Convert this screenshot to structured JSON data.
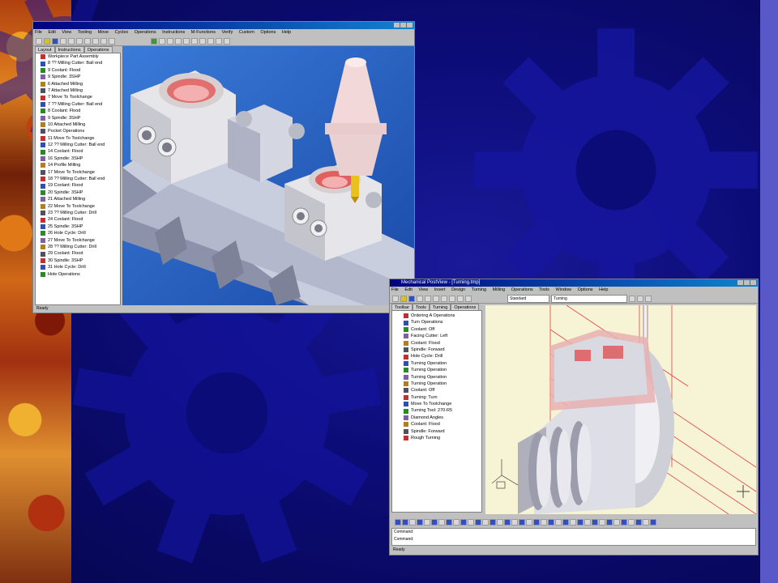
{
  "window1": {
    "title": "",
    "menu": [
      "File",
      "Edit",
      "View",
      "Tooling",
      "Move",
      "Cycles",
      "Operations",
      "Instructions",
      "M-Functions",
      "Verify",
      "Custom",
      "Options",
      "Help"
    ],
    "tabs": [
      "Layout",
      "Instructions",
      "Operations"
    ],
    "tree": [
      "Workpiece Part Assembly",
      "8 ?? Milling Cutter: Ball end",
      "9 Coolant: Flood",
      "9 Spindle: 3SHP",
      "6 Attached Milling",
      "7 Attached Milling",
      "7 Move To Toolchange",
      "7 ?? Milling Cutter: Ball end",
      "8 Coolant: Flood",
      "9 Spindle: 3SHP",
      "10 Attached Milling",
      "Pocket Operations",
      "11 Move To Toolchange",
      "12 ?? Milling Cutter: Ball end",
      "14 Coolant: Flood",
      "16 Spindle: 3SHP",
      "14 Profile Milling",
      "17 Move To Toolchange",
      "18 ?? Milling Cutter: Ball end",
      "19 Coolant: Flood",
      "20 Spindle: 3SHP",
      "21 Attached Milling",
      "22 Move To Toolchange",
      "23 ?? Milling Cutter: Drill",
      "24 Coolant: Flood",
      "25 Spindle: 3SHP",
      "26 Hole Cycle: Drill",
      "27 Move To Toolchange",
      "28 ?? Milling Cutter: Drill",
      "29 Coolant: Flood",
      "30 Spindle: 3SHP",
      "31 Hole Cycle: Drill",
      "Hole Operations"
    ],
    "status_left": "Ready",
    "status_right": ""
  },
  "window2": {
    "title": "Mechanical PostView - [Turning.tmp]",
    "menu": [
      "File",
      "Edit",
      "View",
      "Insert",
      "Design",
      "Turning",
      "Milling",
      "Operations",
      "Tools",
      "Window",
      "Options",
      "Help"
    ],
    "tabs": [
      "Toolbar",
      "Tools",
      "Turning",
      "Operations"
    ],
    "toolbar_field_1": "Standard",
    "toolbar_field_2": "Turning",
    "tree": [
      "Ordering A Operations",
      "Turn Operations",
      "Coolant: Off",
      "Facing Cutter: Left",
      "Coolant: Flood",
      "Spindle: Forward",
      "Hole Cycle: Drill",
      "Turning Operation",
      "Turning Operation",
      "Turning Operation",
      "Turning Operation",
      "Coolant: Off",
      "Turning: Turn",
      "Move To Toolchange",
      "Turning Tool: 270-R5",
      "Diamond Angles",
      "Coolant: Flood",
      "Spindle: Forward",
      "Rough Turning"
    ],
    "command_lines": [
      "Command:",
      "Command:"
    ],
    "status_text": "Ready"
  },
  "colors": {
    "background": "#0c0c78",
    "gear": "#1818a8",
    "accent_bar": "#5858c8",
    "viewport1": "#2a6ac8",
    "viewport2": "#f6f3d8"
  }
}
